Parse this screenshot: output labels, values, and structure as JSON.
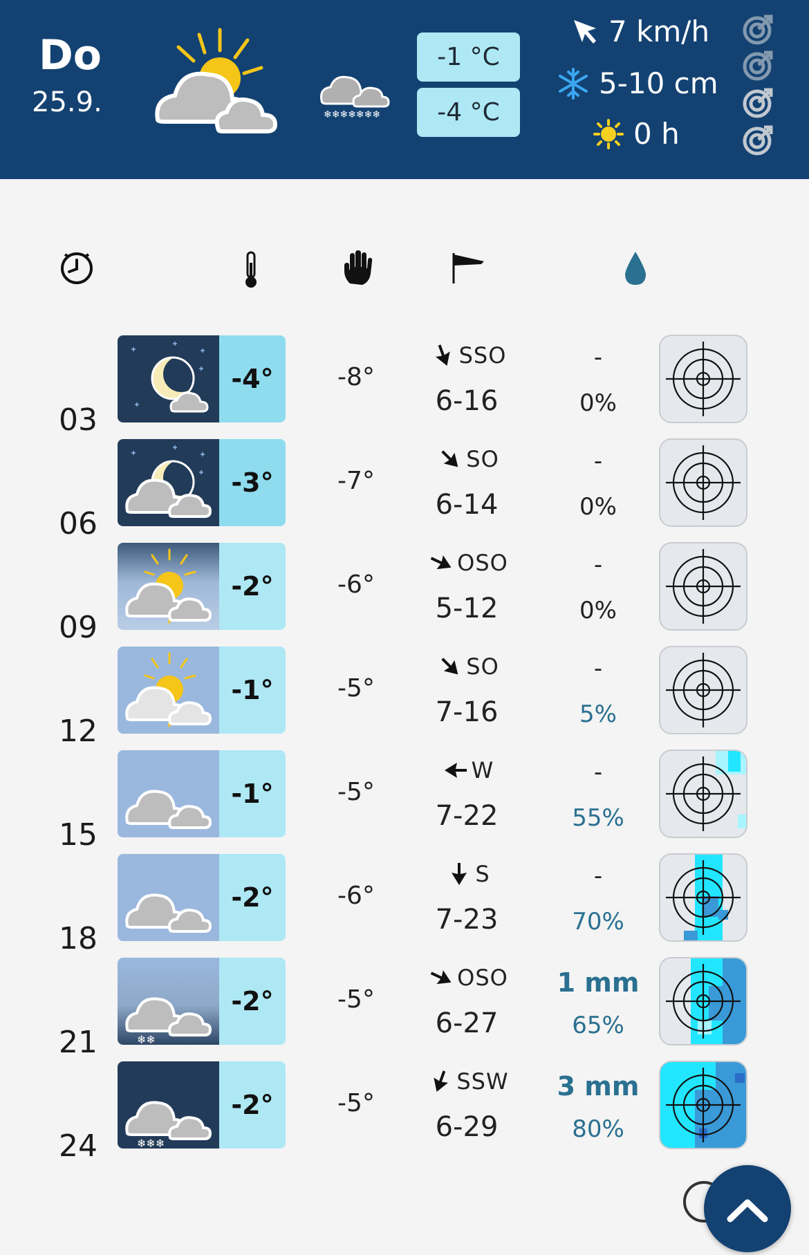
{
  "header": {
    "day": "Do",
    "date": "25.9.",
    "temp_max": "-1 °C",
    "temp_min": "-4 °C",
    "wind": "7 km/h",
    "snow": "5-10 cm",
    "sunshine": "0 h",
    "icons": [
      "partly-sunny-icon",
      "snow-cloud-icon"
    ]
  },
  "columns": [
    "clock-icon",
    "thermometer-icon",
    "hand-icon",
    "windsock-icon",
    "raindrop-icon"
  ],
  "times": [
    "03",
    "06",
    "09",
    "12",
    "15",
    "18",
    "21",
    "24"
  ],
  "rows": [
    {
      "sky": "night-clear",
      "temp": "-4°",
      "feels": "-8°",
      "dir": "SSO",
      "arrow": 160,
      "speed": "6-16",
      "amount": "-",
      "prob": "0%",
      "radar": 0
    },
    {
      "sky": "night-cloudy",
      "temp": "-3°",
      "feels": "-7°",
      "dir": "SO",
      "arrow": 135,
      "speed": "6-14",
      "amount": "-",
      "prob": "0%",
      "radar": 0
    },
    {
      "sky": "dawn-partly",
      "temp": "-2°",
      "feels": "-6°",
      "dir": "OSO",
      "arrow": 115,
      "speed": "5-12",
      "amount": "-",
      "prob": "0%",
      "radar": 0
    },
    {
      "sky": "day-partly",
      "temp": "-1°",
      "feels": "-5°",
      "dir": "SO",
      "arrow": 135,
      "speed": "7-16",
      "amount": "-",
      "prob": "5%",
      "radar": 0
    },
    {
      "sky": "day-cloudy",
      "temp": "-1°",
      "feels": "-5°",
      "dir": "W",
      "arrow": 270,
      "speed": "7-22",
      "amount": "-",
      "prob": "55%",
      "radar": 1
    },
    {
      "sky": "day-cloudy",
      "temp": "-2°",
      "feels": "-6°",
      "dir": "S",
      "arrow": 180,
      "speed": "7-23",
      "amount": "-",
      "prob": "70%",
      "radar": 2
    },
    {
      "sky": "dusk-snow",
      "temp": "-2°",
      "feels": "-5°",
      "dir": "OSO",
      "arrow": 115,
      "speed": "6-27",
      "amount": "1 mm",
      "prob": "65%",
      "radar": 3
    },
    {
      "sky": "night-snow",
      "temp": "-2°",
      "feels": "-5°",
      "dir": "SSW",
      "arrow": 200,
      "speed": "6-29",
      "amount": "3 mm",
      "prob": "80%",
      "radar": 4
    }
  ],
  "colors": {
    "header_bg": "#134272",
    "temp_box": "#aee8f4",
    "precip_text": "#2a7090",
    "radar_cyan": "#22e6ff",
    "radar_blue": "#3a9ad8"
  },
  "buttons": {
    "help": "help-icon",
    "scroll_top": "chevron-up-icon"
  }
}
